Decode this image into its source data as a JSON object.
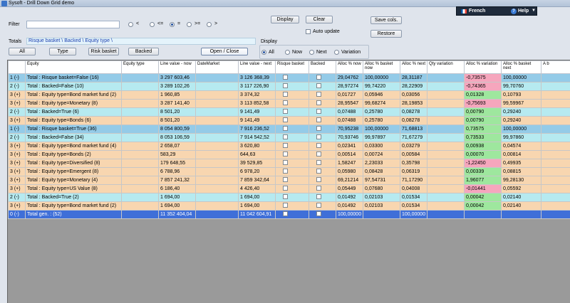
{
  "window": {
    "title": "Sysoft - Drill Down Grid demo"
  },
  "topbar": {
    "language": "French",
    "help": "Help"
  },
  "filter": {
    "label": "Filter",
    "value": ""
  },
  "operators": [
    {
      "label": "<",
      "selected": false
    },
    {
      "label": "<=",
      "selected": false
    },
    {
      "label": "=",
      "selected": true
    },
    {
      "label": ">=",
      "selected": false
    },
    {
      "label": ">",
      "selected": false
    }
  ],
  "buttons": {
    "display": "Display",
    "clear": "Clear",
    "save_cols": "Save cols.",
    "restore": "Restore",
    "auto_update": "Auto update",
    "all": "All",
    "type": "Type",
    "risk_basket": "Risk basket",
    "backed": "Backed",
    "open_close": "Open / Close"
  },
  "totals": {
    "label": "Totals",
    "value": "Risque basket \\ Backed \\ Equity type \\"
  },
  "display_group": {
    "label": "Display",
    "options": [
      {
        "label": "All",
        "selected": true
      },
      {
        "label": "Now",
        "selected": false
      },
      {
        "label": "Next",
        "selected": false
      },
      {
        "label": "Variation",
        "selected": false
      }
    ]
  },
  "grid": {
    "headers": [
      "",
      "Equity",
      "Equity type",
      "Line value - now",
      "DateMarket",
      "Line value - next",
      "Risque basket",
      "Backed",
      "Alloc % now",
      "Alloc % basket now",
      "Alloc % next",
      "Qty variation",
      "Alloc % variation",
      "Alloc % basket next",
      "A b"
    ],
    "rows": [
      {
        "style": "blue",
        "tog": "1 (-)",
        "equity": "Total : Risque basket=False (16)",
        "type": "",
        "lvnow": "3 297 603,46",
        "date": "",
        "lvnext": "3 126 368,39",
        "anow": "29,04762",
        "abnow": "100,00000",
        "anext": "28,31187",
        "qty": "",
        "avar": "-0,73575",
        "vsign": "neg",
        "abnext": "100,00000"
      },
      {
        "style": "cyan",
        "tog": "2 (-)",
        "equity": "Total : Backed=False (10)",
        "type": "",
        "lvnow": "3 289 102,26",
        "date": "",
        "lvnext": "3 117 226,90",
        "anow": "28,97274",
        "abnow": "99,74220",
        "anext": "28,22909",
        "qty": "",
        "avar": "-0,74365",
        "vsign": "neg",
        "abnext": "99,70760"
      },
      {
        "style": "orange",
        "tog": "3 (+)",
        "equity": "Total : Equity type=Bond market fund (2)",
        "type": "",
        "lvnow": "1 960,85",
        "date": "",
        "lvnext": "3 374,32",
        "anow": "0,01727",
        "abnow": "0,05946",
        "anext": "0,03056",
        "qty": "",
        "avar": "0,01328",
        "vsign": "pos",
        "abnext": "0,10793"
      },
      {
        "style": "orange",
        "tog": "3 (+)",
        "equity": "Total : Equity type=Monetary (8)",
        "type": "",
        "lvnow": "3 287 141,40",
        "date": "",
        "lvnext": "3 113 852,58",
        "anow": "28,95547",
        "abnow": "99,68274",
        "anext": "28,19853",
        "qty": "",
        "avar": "-0,75693",
        "vsign": "neg",
        "abnext": "99,59967"
      },
      {
        "style": "cyan",
        "tog": "2 (-)",
        "equity": "Total : Backed=True (6)",
        "type": "",
        "lvnow": "8 501,20",
        "date": "",
        "lvnext": "9 141,49",
        "anow": "0,07488",
        "abnow": "0,25780",
        "anext": "0,08278",
        "qty": "",
        "avar": "0,00790",
        "vsign": "pos",
        "abnext": "0,29240"
      },
      {
        "style": "orange",
        "tog": "3 (+)",
        "equity": "Total : Equity type=Bonds (6)",
        "type": "",
        "lvnow": "8 501,20",
        "date": "",
        "lvnext": "9 141,49",
        "anow": "0,07488",
        "abnow": "0,25780",
        "anext": "0,08278",
        "qty": "",
        "avar": "0,00790",
        "vsign": "pos",
        "abnext": "0,29240"
      },
      {
        "style": "blue",
        "tog": "1 (-)",
        "equity": "Total : Risque basket=True (36)",
        "type": "",
        "lvnow": "8 054 800,59",
        "date": "",
        "lvnext": "7 916 236,52",
        "anow": "70,95238",
        "abnow": "100,00000",
        "anext": "71,68813",
        "qty": "",
        "avar": "0,73575",
        "vsign": "pos",
        "abnext": "100,00000"
      },
      {
        "style": "cyan",
        "tog": "2 (-)",
        "equity": "Total : Backed=False (34)",
        "type": "",
        "lvnow": "8 053 106,59",
        "date": "",
        "lvnext": "7 914 542,52",
        "anow": "70,93746",
        "abnow": "99,97897",
        "anext": "71,67279",
        "qty": "",
        "avar": "0,73533",
        "vsign": "pos",
        "abnext": "99,97860"
      },
      {
        "style": "orange",
        "tog": "3 (+)",
        "equity": "Total : Equity type=Bond market fund (4)",
        "type": "",
        "lvnow": "2 658,07",
        "date": "",
        "lvnext": "3 620,80",
        "anow": "0,02341",
        "abnow": "0,03300",
        "anext": "0,03279",
        "qty": "",
        "avar": "0,00938",
        "vsign": "pos",
        "abnext": "0,04574"
      },
      {
        "style": "orange",
        "tog": "3 (+)",
        "equity": "Total : Equity type=Bonds (2)",
        "type": "",
        "lvnow": "583,29",
        "date": "",
        "lvnext": "644,63",
        "anow": "0,00514",
        "abnow": "0,00724",
        "anext": "0,00584",
        "qty": "",
        "avar": "0,00070",
        "vsign": "pos",
        "abnext": "0,00814"
      },
      {
        "style": "orange",
        "tog": "3 (+)",
        "equity": "Total : Equity type=Diversified (8)",
        "type": "",
        "lvnow": "179 648,55",
        "date": "",
        "lvnext": "39 529,85",
        "anow": "1,58247",
        "abnow": "2,23033",
        "anext": "0,35798",
        "qty": "",
        "avar": "-1,22450",
        "vsign": "neg",
        "abnext": "0,49935"
      },
      {
        "style": "orange",
        "tog": "3 (+)",
        "equity": "Total : Equity type=Emergent (8)",
        "type": "",
        "lvnow": "6 788,96",
        "date": "",
        "lvnext": "6 978,20",
        "anow": "0,05980",
        "abnow": "0,08428",
        "anext": "0,06319",
        "qty": "",
        "avar": "0,00339",
        "vsign": "pos",
        "abnext": "0,08815"
      },
      {
        "style": "orange",
        "tog": "3 (+)",
        "equity": "Total : Equity type=Monetary (4)",
        "type": "",
        "lvnow": "7 857 241,32",
        "date": "",
        "lvnext": "7 859 342,64",
        "anow": "69,21214",
        "abnow": "97,54731",
        "anext": "71,17290",
        "qty": "",
        "avar": "1,96077",
        "vsign": "pos",
        "abnext": "99,28130"
      },
      {
        "style": "orange",
        "tog": "3 (+)",
        "equity": "Total : Equity type=US Value (8)",
        "type": "",
        "lvnow": "6 186,40",
        "date": "",
        "lvnext": "4 426,40",
        "anow": "0,05449",
        "abnow": "0,07680",
        "anext": "0,04008",
        "qty": "",
        "avar": "-0,01441",
        "vsign": "neg",
        "abnext": "0,05592"
      },
      {
        "style": "cyan",
        "tog": "2 (-)",
        "equity": "Total : Backed=True (2)",
        "type": "",
        "lvnow": "1 694,00",
        "date": "",
        "lvnext": "1 694,00",
        "anow": "0,01492",
        "abnow": "0,02103",
        "anext": "0,01534",
        "qty": "",
        "avar": "0,00042",
        "vsign": "pos",
        "abnext": "0,02140"
      },
      {
        "style": "orange",
        "tog": "3 (+)",
        "equity": "Total : Equity type=Bond market fund (2)",
        "type": "",
        "lvnow": "1 694,00",
        "date": "",
        "lvnext": "1 694,00",
        "anow": "0,01492",
        "abnow": "0,02103",
        "anext": "0,01534",
        "qty": "",
        "avar": "0,00042",
        "vsign": "pos",
        "abnext": "0,02140"
      },
      {
        "style": "total",
        "tog": "0 (-)",
        "equity": "Total gen. : (52)",
        "type": "",
        "lvnow": "11 352 404,04",
        "date": "",
        "lvnext": "11 042 604,91",
        "anow": "100,00000",
        "abnow": "",
        "anext": "100,00000",
        "qty": "",
        "avar": "",
        "vsign": "",
        "abnext": ""
      }
    ]
  },
  "colors": {
    "row_level1": "#94cbe8",
    "row_level2": "#b6eaf0",
    "row_level3": "#f8d6b0",
    "row_total": "#3f6fd8",
    "positive": "#9ee79e",
    "negative": "#f6a6bd"
  }
}
